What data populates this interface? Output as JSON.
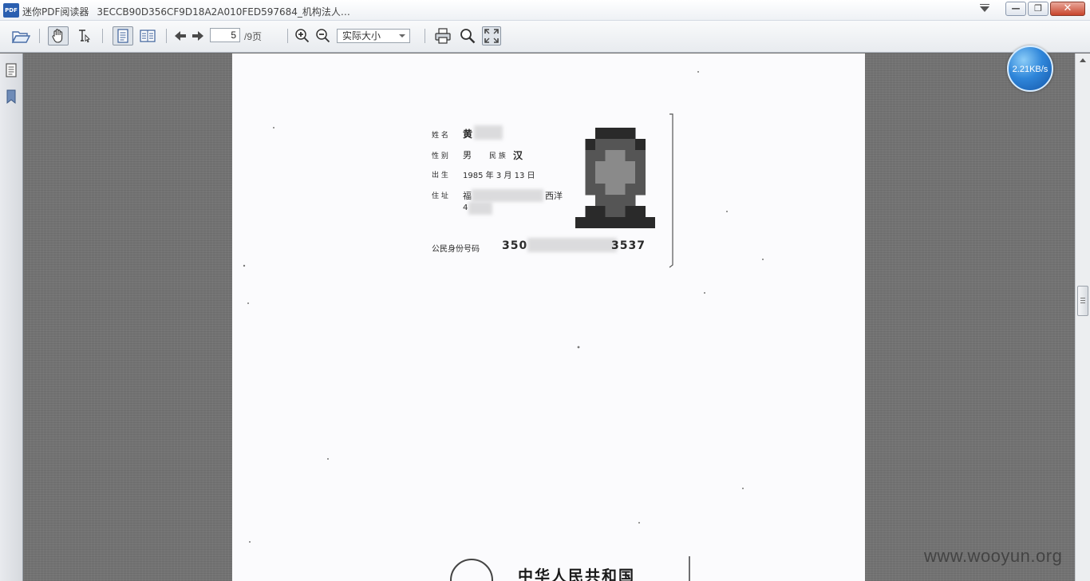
{
  "window": {
    "app_icon_label": "PDF",
    "app_name": "迷你PDF阅读器",
    "document_title": "3ECCB90D356CF9D18A2A010FED597684_机构法人…",
    "minimize_glyph": "—",
    "restore_glyph": "❐",
    "close_glyph": "✕"
  },
  "toolbar": {
    "page_current": "5",
    "page_total": "/9页",
    "zoom_value": "实际大小"
  },
  "status": {
    "download_speed": "2.21KB/s"
  },
  "document": {
    "id_card": {
      "name_label": "姓 名",
      "name_value": "黄",
      "sex_label": "性 别",
      "sex_value": "男",
      "ethnicity_label": "民 族",
      "ethnicity_value": "汉",
      "birth_label": "出 生",
      "birth_year": "1985",
      "birth_year_unit": "年",
      "birth_month": "3",
      "birth_month_unit": "月",
      "birth_day": "13",
      "birth_day_unit": "日",
      "address_label": "住 址",
      "address_line1_start": "福",
      "address_line1_end": "西洋",
      "address_line2_start": "4",
      "id_number_label": "公民身份号码",
      "id_number_start": "350",
      "id_number_end": "3537"
    },
    "back_side_heading": "中华人民共和国"
  },
  "watermark": "www.wooyun.org",
  "colors": {
    "speed_bubble": "#2f86da",
    "viewer_background": "#737373",
    "page_background": "#fbfbfd"
  },
  "icons": [
    "pdf-app-icon",
    "open-folder-icon",
    "hand-tool-icon",
    "text-select-icon",
    "single-page-icon",
    "two-page-icon",
    "previous-page-icon",
    "next-page-icon",
    "zoom-in-icon",
    "zoom-out-icon",
    "print-icon",
    "search-icon",
    "fullscreen-icon",
    "thumbnails-icon",
    "bookmark-icon"
  ]
}
